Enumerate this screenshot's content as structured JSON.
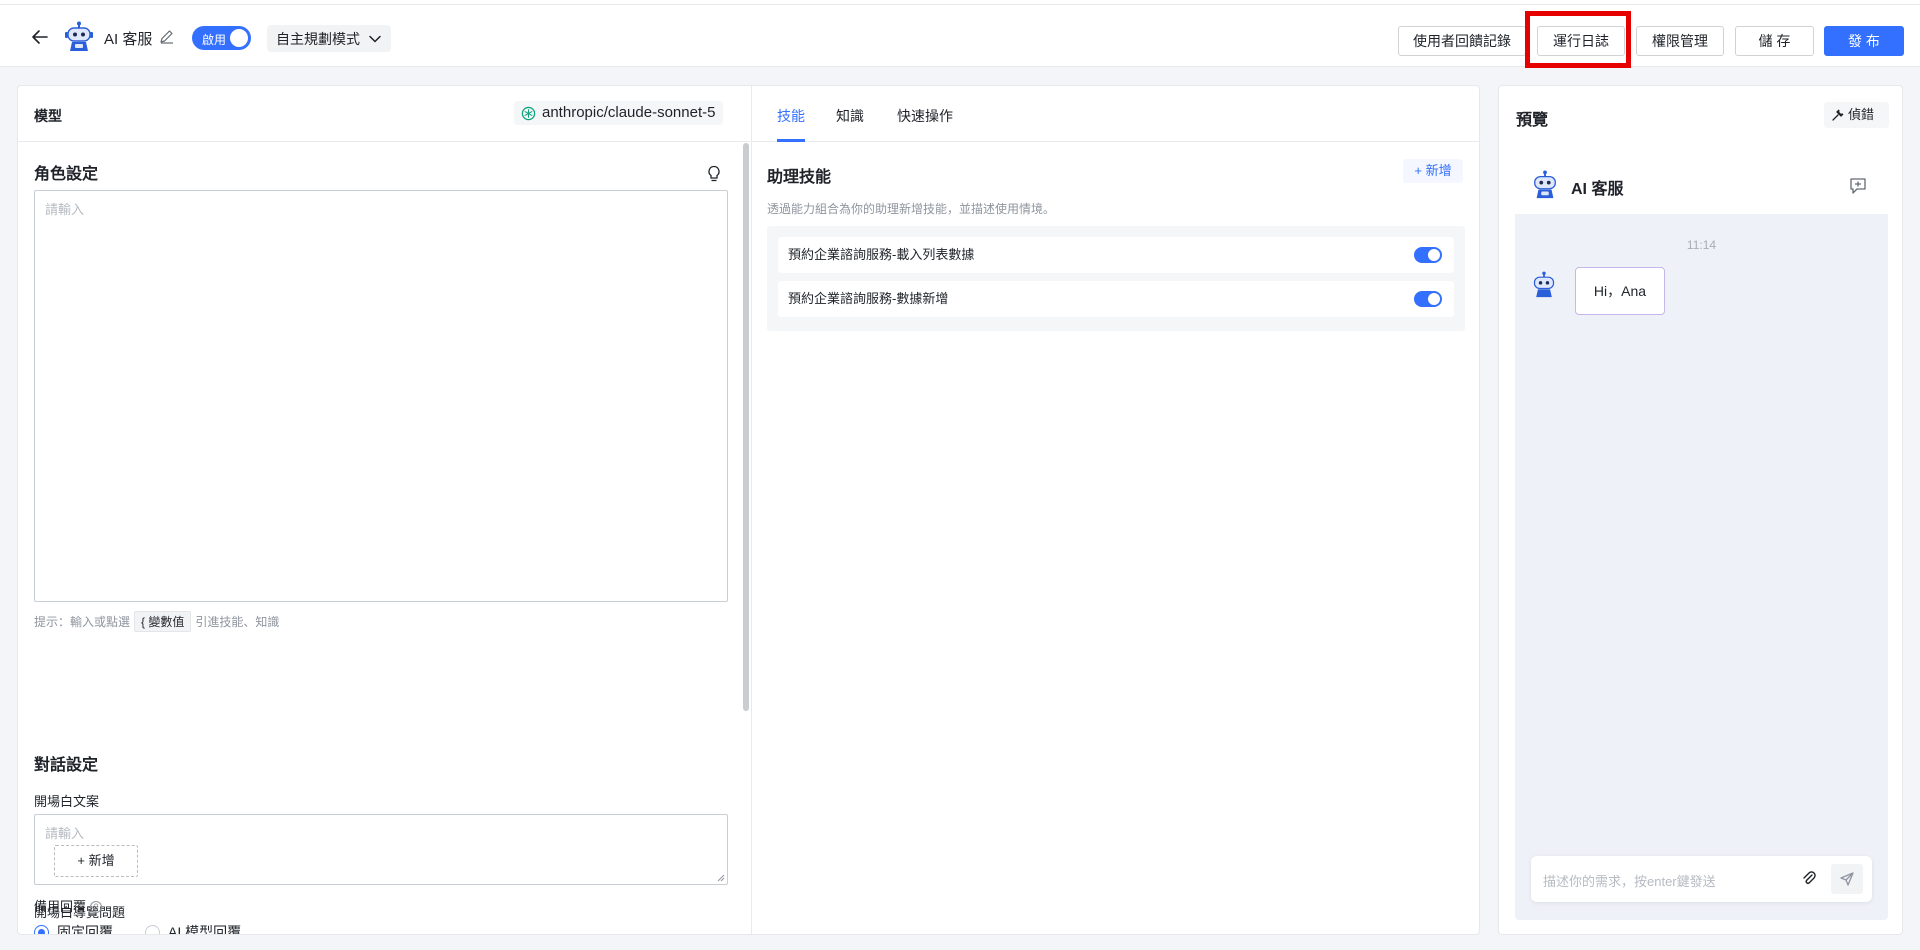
{
  "header": {
    "title": "AI 客服",
    "toggle_label": "啟用",
    "mode_label": "自主規劃模式",
    "buttons": {
      "feedback": "使用者回饋記錄",
      "run_log": "運行日誌",
      "permissions": "權限管理",
      "save": "儲 存",
      "publish": "發 布"
    }
  },
  "model": {
    "label": "模型",
    "name": "anthropic/claude-sonnet-5"
  },
  "role": {
    "title": "角色設定",
    "placeholder": "請輸入",
    "hint_prefix": "提示：輸入或點選",
    "hint_chip": "{ 變數值",
    "hint_suffix": "引進技能、知識"
  },
  "dialog": {
    "title": "對話設定",
    "opening_label": "開場白文案",
    "opening_placeholder": "請輸入",
    "guide_label": "開場白導覽問題",
    "add_label": "+ 新增",
    "fallback_label": "備用回覆",
    "fallback_options": [
      "固定回覆",
      "AI 模型回覆"
    ],
    "fallback_selected": "固定回覆"
  },
  "tabs": [
    "技能",
    "知識",
    "快速操作"
  ],
  "skills": {
    "title": "助理技能",
    "add_label": "+ 新增",
    "description": "透過能力組合為你的助理新增技能，並描述使用情境。",
    "items": [
      {
        "label": "預約企業諮詢服務-載入列表數據",
        "enabled": true
      },
      {
        "label": "預約企業諮詢服務-數據新增",
        "enabled": true
      }
    ]
  },
  "preview": {
    "title": "預覽",
    "debug_label": "偵錯",
    "bot_name": "AI 客服",
    "timestamp": "11:14",
    "message": "Hi，Ana",
    "input_placeholder": "描述你的需求，按enter鍵發送"
  },
  "colors": {
    "accent": "#3370ff",
    "highlight": "#e60000"
  }
}
